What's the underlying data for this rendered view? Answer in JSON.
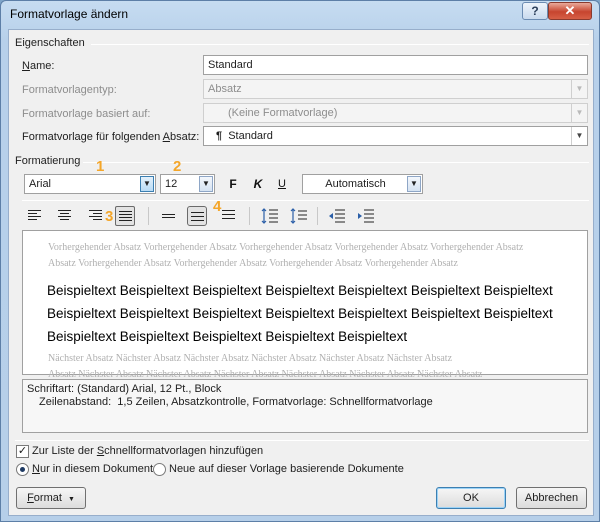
{
  "window": {
    "title": "Formatvorlage ändern",
    "help": "?",
    "close": "✕"
  },
  "properties": {
    "section": "Eigenschaften",
    "name_label": "Name:",
    "name_value": "Standard",
    "type_label": "Formatvorlagentyp:",
    "type_value": "Absatz",
    "based_label": "Formatvorlage basiert auf:",
    "based_value": "(Keine Formatvorlage)",
    "next_label": "Formatvorlage für folgenden Absatz:",
    "next_value": "Standard",
    "pilcrow": "¶"
  },
  "formatting": {
    "section": "Formatierung",
    "font": "Arial",
    "size": "12",
    "bold": "F",
    "italic": "K",
    "underline": "U",
    "color": "Automatisch",
    "callouts": [
      "1",
      "2",
      "3",
      "4"
    ]
  },
  "preview": {
    "previous_1": "Vorhergehender Absatz Vorhergehender Absatz Vorhergehender Absatz Vorhergehender Absatz Vorhergehender Absatz",
    "previous_2": "Absatz Vorhergehender Absatz Vorhergehender Absatz Vorhergehender Absatz Vorhergehender Absatz",
    "main_1": "Beispieltext Beispieltext Beispieltext Beispieltext Beispieltext Beispieltext Beispieltext",
    "main_2": "Beispieltext Beispieltext Beispieltext Beispieltext Beispieltext Beispieltext Beispieltext",
    "main_3": "Beispieltext Beispieltext Beispieltext Beispieltext Beispieltext",
    "next_1": "Nächster Absatz Nächster Absatz Nächster Absatz Nächster Absatz Nächster Absatz Nächster Absatz",
    "next_2": "Absatz Nächster Absatz Nächster Absatz Nächster Absatz Nächster Absatz Nächster Absatz Nächster Absatz"
  },
  "description": {
    "line_1": "Schriftart: (Standard) Arial, 12 Pt., Block",
    "line_2": "Zeilenabstand:  1,5 Zeilen, Absatzkontrolle, Formatvorlage: Schnellformatvorlage"
  },
  "options": {
    "add_to_quick_prefix": "Zur Liste der ",
    "add_to_quick_underline": "S",
    "add_to_quick_suffix": "chnellformatvorlagen hinzufügen",
    "only_doc_underline": "N",
    "only_doc_suffix": "ur in diesem Dokument",
    "new_docs": "Neue auf dieser Vorlage basierende Dokumente"
  },
  "buttons": {
    "format": "Format",
    "format_underline": "F",
    "format_rest": "ormat",
    "ok": "OK",
    "cancel": "Abbrechen"
  }
}
